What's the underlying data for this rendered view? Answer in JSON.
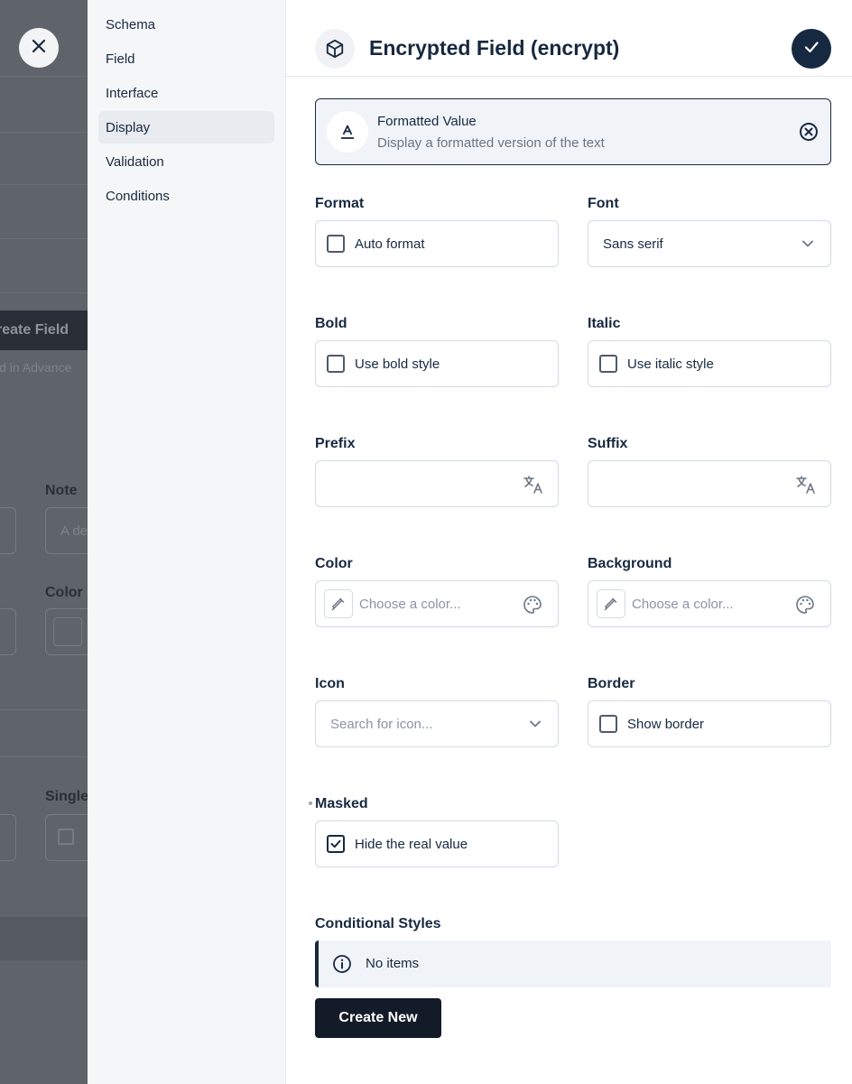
{
  "background": {
    "create_field_label": "reate Field",
    "advanced_text": "ld in Advance",
    "note_label": "Note",
    "note_placeholder": "A de",
    "color_label": "Color",
    "single_label": "Single"
  },
  "nav": {
    "items": [
      {
        "label": "Schema"
      },
      {
        "label": "Field"
      },
      {
        "label": "Interface"
      },
      {
        "label": "Display"
      },
      {
        "label": "Validation"
      },
      {
        "label": "Conditions"
      }
    ],
    "active": "Display"
  },
  "header": {
    "title": "Encrypted Field (encrypt)",
    "icon": "box-icon"
  },
  "display_card": {
    "title": "Formatted Value",
    "subtitle": "Display a formatted version of the text",
    "icon": "text-format-icon"
  },
  "fields": {
    "format": {
      "label": "Format",
      "checkbox": "Auto format",
      "checked": false
    },
    "font": {
      "label": "Font",
      "value": "Sans serif"
    },
    "bold": {
      "label": "Bold",
      "checkbox": "Use bold style",
      "checked": false
    },
    "italic": {
      "label": "Italic",
      "checkbox": "Use italic style",
      "checked": false
    },
    "prefix": {
      "label": "Prefix",
      "value": ""
    },
    "suffix": {
      "label": "Suffix",
      "value": ""
    },
    "color": {
      "label": "Color",
      "placeholder": "Choose a color..."
    },
    "background": {
      "label": "Background",
      "placeholder": "Choose a color..."
    },
    "icon": {
      "label": "Icon",
      "placeholder": "Search for icon..."
    },
    "border": {
      "label": "Border",
      "checkbox": "Show border",
      "checked": false
    },
    "masked": {
      "label": "Masked",
      "checkbox": "Hide the real value",
      "checked": true
    }
  },
  "conditional_styles": {
    "label": "Conditional Styles",
    "empty_text": "No items",
    "create_label": "Create New"
  },
  "colors": {
    "primary": "#172940",
    "accent_button": "#141b28",
    "nav_background": "#f5f6f8"
  }
}
